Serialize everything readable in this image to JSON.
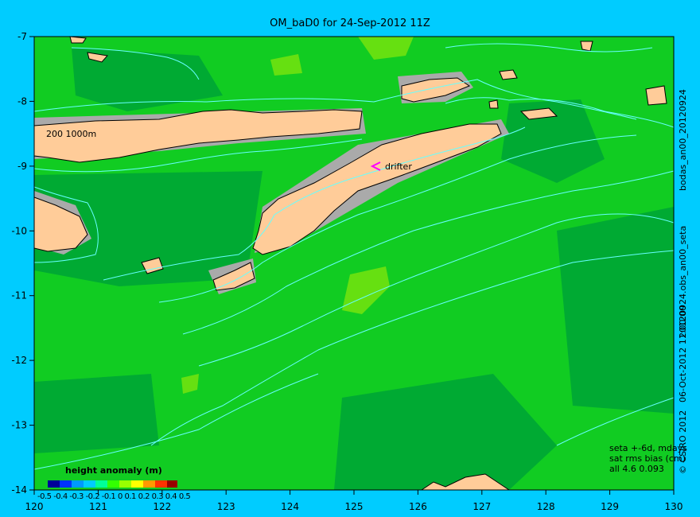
{
  "title": "OM_baD0 for 24-Sep-2012 11Z",
  "contour_label": "200  1000m",
  "drifter_label": "drifter",
  "x_ticks": [
    "120",
    "121",
    "122",
    "123",
    "124",
    "125",
    "126",
    "127",
    "128",
    "129",
    "130"
  ],
  "y_ticks": [
    "-7",
    "-8",
    "-9",
    "-10",
    "-11",
    "-12",
    "-13",
    "-14"
  ],
  "side_text_1": "bodas_an00_20120924",
  "side_text_2": "20120924.obs_an00_seta",
  "side_text_3": "06-Oct-2012 11:00:00",
  "side_text_4": "© CSIRO 2012",
  "stats": {
    "line1": "seta +-6d, mdays",
    "line2": "sat rms bias (cm)",
    "line3": "all 4.6 0.093"
  },
  "colorbar": {
    "title": "height anomaly  (m)",
    "ticks": "-0.5 -0.4 -0.3 -0.2 -0.1 0 0.1 0.2 0.3 0.4 0.5",
    "colors": [
      "#000099",
      "#0033ff",
      "#0099ff",
      "#00ccff",
      "#00ff99",
      "#33ff00",
      "#99ff00",
      "#ffff00",
      "#ff9900",
      "#ff3300",
      "#990000"
    ]
  },
  "colors": {
    "background": "#00ccff",
    "sea_base": "#11cc22",
    "sea_dark": "#00aa33",
    "sea_light": "#55dd11",
    "land": "#ffcc99",
    "shelf": "#aaaaaa",
    "contour": "#66ffff",
    "drifter": "#ff00ff"
  }
}
